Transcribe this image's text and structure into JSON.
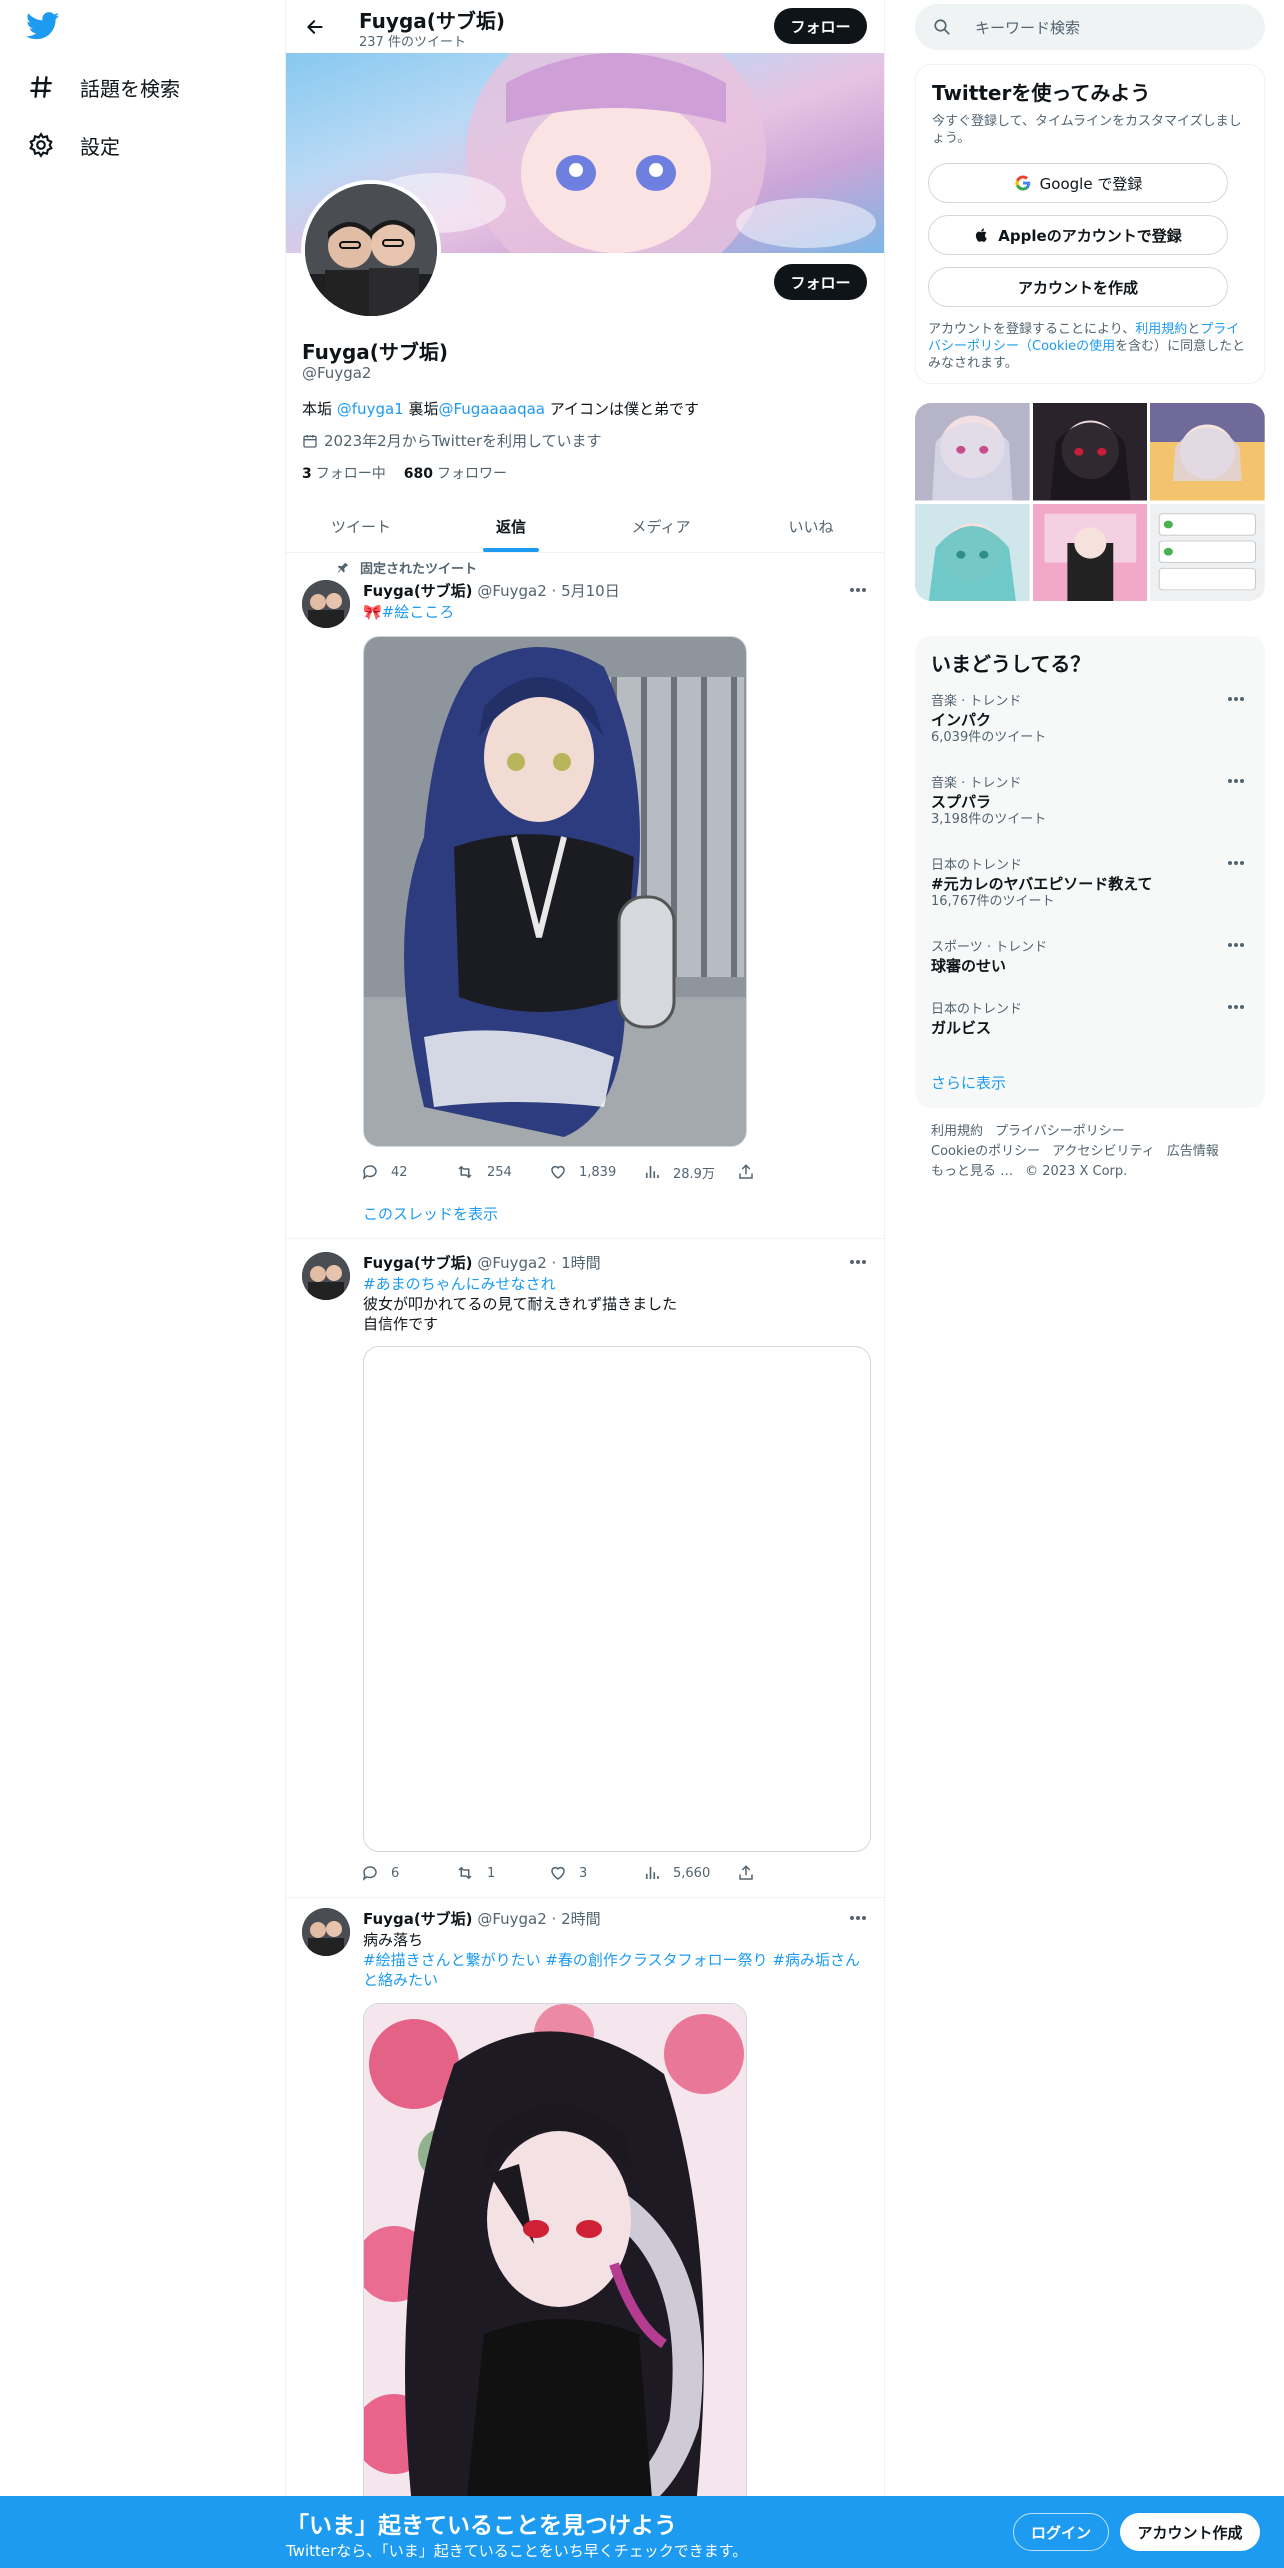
{
  "nav": {
    "items": [
      {
        "label": "話題を検索",
        "icon": "hashtag-icon"
      },
      {
        "label": "設定",
        "icon": "gear-icon"
      }
    ]
  },
  "header": {
    "name": "Fuyga(サブ垢)",
    "tweet_count": "237 件のツイート",
    "follow_label": "フォロー"
  },
  "profile": {
    "follow_label": "フォロー",
    "name": "Fuyga(サブ垢)",
    "handle": "@Fuyga2",
    "bio_prefix": "本垢 ",
    "bio_mention1": "@fuyga1",
    "bio_middle": " 裏垢",
    "bio_mention2": "@Fugaaaaqaa",
    "bio_suffix": " アイコンは僕と弟です",
    "joined": "2023年2月からTwitterを利用しています",
    "following_count": "3",
    "following_label": "フォロー中",
    "followers_count": "680",
    "followers_label": "フォロワー"
  },
  "tabs": [
    {
      "label": "ツイート",
      "active": false
    },
    {
      "label": "返信",
      "active": true
    },
    {
      "label": "メディア",
      "active": false
    },
    {
      "label": "いいね",
      "active": false
    }
  ],
  "tweets": [
    {
      "pinned_label": "固定されたツイート",
      "name": "Fuyga(サブ垢)",
      "meta": "@Fuyga2 · 5月10日",
      "text": "🎀#絵こころ",
      "replies": "42",
      "retweets": "254",
      "likes": "1,839",
      "views": "28.9万",
      "thread_link": "このスレッドを表示"
    },
    {
      "name": "Fuyga(サブ垢)",
      "meta": "@Fuyga2 · 1時間",
      "hashtag": "#あまのちゃんにみせなされ",
      "line1": "彼女が叩かれてるの見て耐えきれず描きました",
      "line2": "自信作です",
      "replies": "6",
      "retweets": "1",
      "likes": "3",
      "views": "5,660"
    },
    {
      "name": "Fuyga(サブ垢)",
      "meta": "@Fuyga2 · 2時間",
      "line1": "病み落ち",
      "hashtags_line1": "#絵描きさんと繋がりたい #春の創作クラスタフォロー祭り #病み垢さん",
      "hashtags_line2": "と絡みたい"
    }
  ],
  "search": {
    "placeholder": "キーワード検索"
  },
  "signup": {
    "title": "Twitterを使ってみよう",
    "subtitle": "今すぐ登録して、タイムラインをカスタマイズしましょう。",
    "google": "Google で登録",
    "apple": "Appleのアカウントで登録",
    "create": "アカウントを作成",
    "legal_prefix": "アカウントを登録することにより、",
    "legal_terms": "利用規約",
    "legal_and": "と",
    "legal_privacy": "プライバシーポリシー（Cookieの使用",
    "legal_suffix": "を含む）に同意したとみなされます。"
  },
  "trends": {
    "title": "いまどうしてる？",
    "items": [
      {
        "category": "音楽 · トレンド",
        "title": "インパク",
        "count": "6,039件のツイート"
      },
      {
        "category": "音楽 · トレンド",
        "title": "スプパラ",
        "count": "3,198件のツイート"
      },
      {
        "category": "日本のトレンド",
        "title": "#元カレのヤバエピソード教えて",
        "count": "16,767件のツイート"
      },
      {
        "category": "スポーツ · トレンド",
        "title": "球審のせい",
        "count": ""
      },
      {
        "category": "日本のトレンド",
        "title": "ガルビス",
        "count": ""
      }
    ],
    "more": "さらに表示"
  },
  "footer": {
    "links": [
      "利用規約",
      "プライバシーポリシー",
      "Cookieのポリシー",
      "アクセシビリティ",
      "広告情報",
      "もっと見る …",
      "© 2023 X Corp."
    ]
  },
  "bottombar": {
    "title": "「いま」起きていることを見つけよう",
    "subtitle": "Twitterなら、「いま」起きていることをいち早くチェックできます。",
    "login": "ログイン",
    "signup": "アカウント作成"
  },
  "colors": {
    "accent": "#1d9bf0",
    "dark": "#0f1419",
    "muted": "#536471"
  }
}
